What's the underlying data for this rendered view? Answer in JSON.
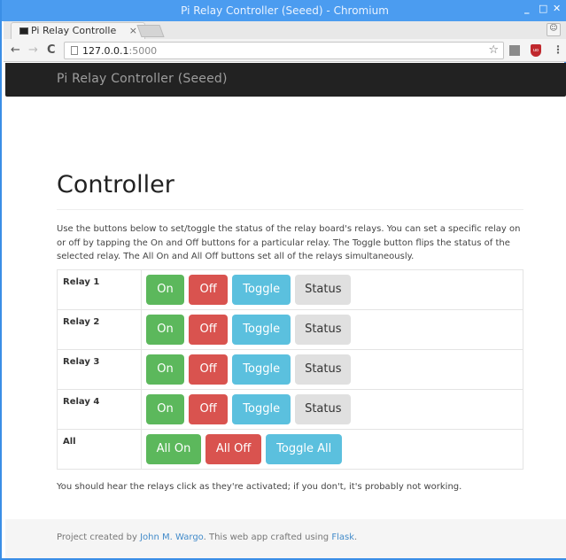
{
  "window": {
    "title": "Pi Relay Controller (Seeed) - Chromium",
    "controls": {
      "minimize": "_",
      "maximize": "□",
      "close": "✕"
    }
  },
  "browser": {
    "tab": {
      "label": "Pi Relay Controlle",
      "close": "×"
    },
    "profile_icon": "👤",
    "nav": {
      "back": "←",
      "forward": "→",
      "reload": "C"
    },
    "url": {
      "host": "127.0.0.1",
      "port": ":5000"
    },
    "star": "☆",
    "menu": "⋮",
    "ext_label": "uo"
  },
  "site": {
    "brand": "Pi Relay Controller (Seeed)",
    "heading": "Controller",
    "intro": "Use the buttons below to set/toggle the status of the relay board's relays. You can set a specific relay on or off by tapping the On and Off buttons for a particular relay. The Toggle button flips the status of the selected relay. The All On and All Off buttons set all of the relays simultaneously.",
    "relays": [
      {
        "label": "Relay 1",
        "on": "On",
        "off": "Off",
        "toggle": "Toggle",
        "status": "Status"
      },
      {
        "label": "Relay 2",
        "on": "On",
        "off": "Off",
        "toggle": "Toggle",
        "status": "Status"
      },
      {
        "label": "Relay 3",
        "on": "On",
        "off": "Off",
        "toggle": "Toggle",
        "status": "Status"
      },
      {
        "label": "Relay 4",
        "on": "On",
        "off": "Off",
        "toggle": "Toggle",
        "status": "Status"
      }
    ],
    "all": {
      "label": "All",
      "on": "All On",
      "off": "All Off",
      "toggle": "Toggle All"
    },
    "note": "You should hear the relays click as they're activated; if you don't, it's probably not working.",
    "footer": {
      "prefix": "Project created by ",
      "author": "John M. Wargo",
      "middle": ". This web app crafted using ",
      "framework": "Flask",
      "suffix": "."
    }
  },
  "colors": {
    "success": "#5cb85c",
    "danger": "#d9534f",
    "info": "#5bc0de",
    "default": "#e0e0e0",
    "navbar": "#222222",
    "titlebar": "#4b9cf0"
  }
}
